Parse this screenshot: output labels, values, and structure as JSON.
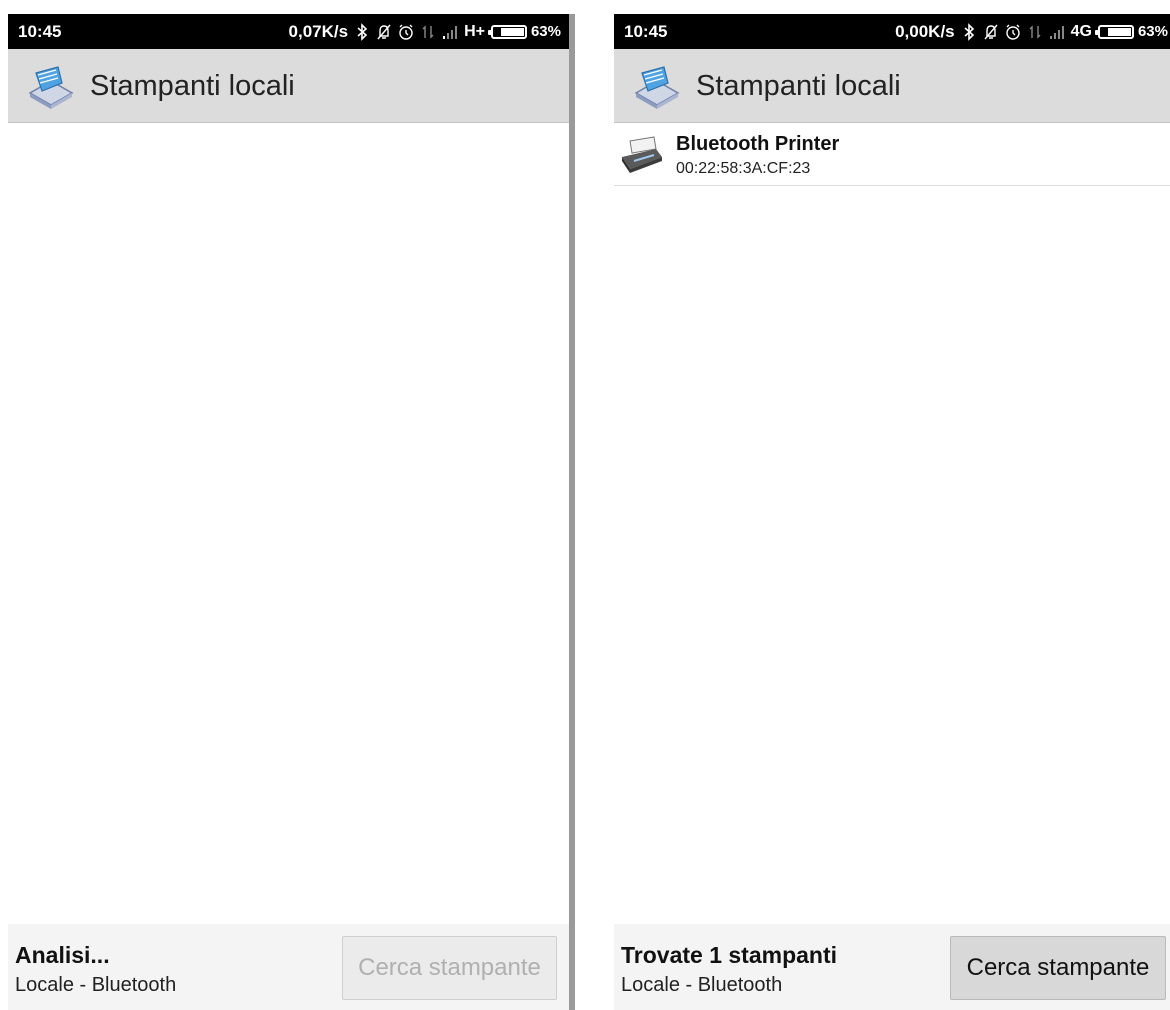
{
  "screens": [
    {
      "status_bar": {
        "time": "10:45",
        "speed": "0,07K/s",
        "network": "H+",
        "battery": "63%",
        "battery_level": 0.63
      },
      "action_bar": {
        "title": "Stampanti locali"
      },
      "printers": [],
      "footer": {
        "status": "Analisi...",
        "subtitle": "Locale - Bluetooth",
        "button_label": "Cerca stampante",
        "button_enabled": false
      }
    },
    {
      "status_bar": {
        "time": "10:45",
        "speed": "0,00K/s",
        "network": "4G",
        "battery": "63%",
        "battery_level": 0.63
      },
      "action_bar": {
        "title": "Stampanti locali"
      },
      "printers": [
        {
          "name": "Bluetooth Printer",
          "address": "00:22:58:3A:CF:23"
        }
      ],
      "footer": {
        "status": "Trovate 1 stampanti",
        "subtitle": "Locale - Bluetooth",
        "button_label": "Cerca stampante",
        "button_enabled": true
      }
    }
  ],
  "icons": {
    "status": [
      "bluetooth-icon",
      "notifications-off-icon",
      "alarm-icon",
      "data-transfer-icon",
      "signal-icon",
      "battery-icon"
    ],
    "app": "printer-app-icon",
    "printer": "printer-icon"
  },
  "colors": {
    "status_bar": "#000000",
    "action_bar": "#dcdcdc",
    "footer": "#f4f4f4",
    "button_enabled": "#d8d8d8",
    "button_disabled_text": "#b0b0b0"
  }
}
